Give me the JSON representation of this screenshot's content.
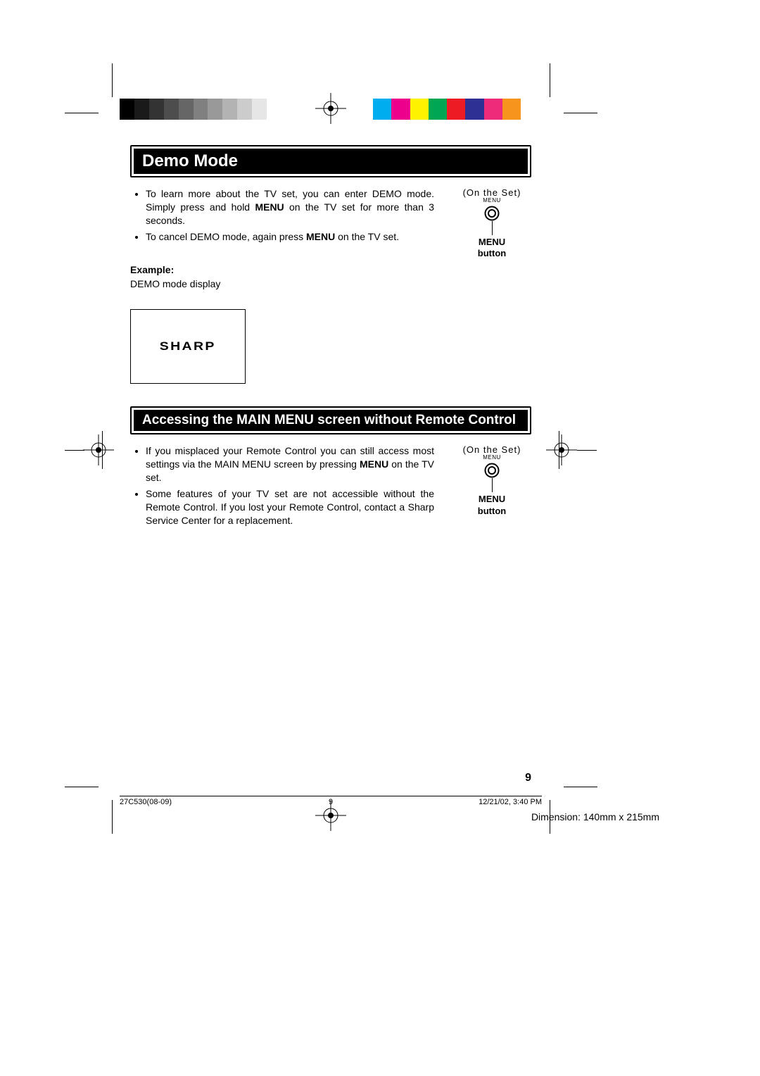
{
  "colors": {
    "grays": [
      "#000000",
      "#1a1a1a",
      "#333333",
      "#4d4d4d",
      "#666666",
      "#808080",
      "#999999",
      "#b3b3b3",
      "#cccccc",
      "#e6e6e6",
      "#ffffff"
    ],
    "hues": [
      "#00aeef",
      "#ec008c",
      "#fff200",
      "#00a651",
      "#ed1c24",
      "#2e3192",
      "#ee2a7b",
      "#f7941e"
    ]
  },
  "section1": {
    "title": "Demo Mode",
    "bullets": [
      {
        "pre": "To learn more about the TV set, you can enter DEMO mode. Simply press and hold ",
        "bold": "MENU",
        "post": " on the TV set for more than 3 seconds."
      },
      {
        "pre": "To cancel DEMO mode, again press ",
        "bold": "MENU",
        "post": " on the TV set."
      }
    ],
    "example_label": "Example:",
    "example_sub": "DEMO mode display",
    "brand": "SHARP"
  },
  "menu_figure": {
    "on_set": "(On the Set)",
    "tiny": "MENU",
    "caption_l1": "MENU",
    "caption_l2": "button"
  },
  "section2": {
    "title": "Accessing the MAIN MENU screen without Remote Control",
    "bullets": [
      {
        "pre": "If you misplaced your Remote Control you can still access most settings via the MAIN MENU screen by pressing ",
        "bold": "MENU",
        "post": " on the TV set."
      },
      {
        "pre": "Some features of your TV set are not accessible without the Remote Control. If you lost your Remote Control, contact a Sharp Service Center for a replacement.",
        "bold": "",
        "post": ""
      }
    ]
  },
  "page_num": "9",
  "footer": {
    "left": "27C530(08-09)",
    "center": "9",
    "right": "12/21/02, 3:40 PM"
  },
  "dimension": "Dimension: 140mm x 215mm"
}
